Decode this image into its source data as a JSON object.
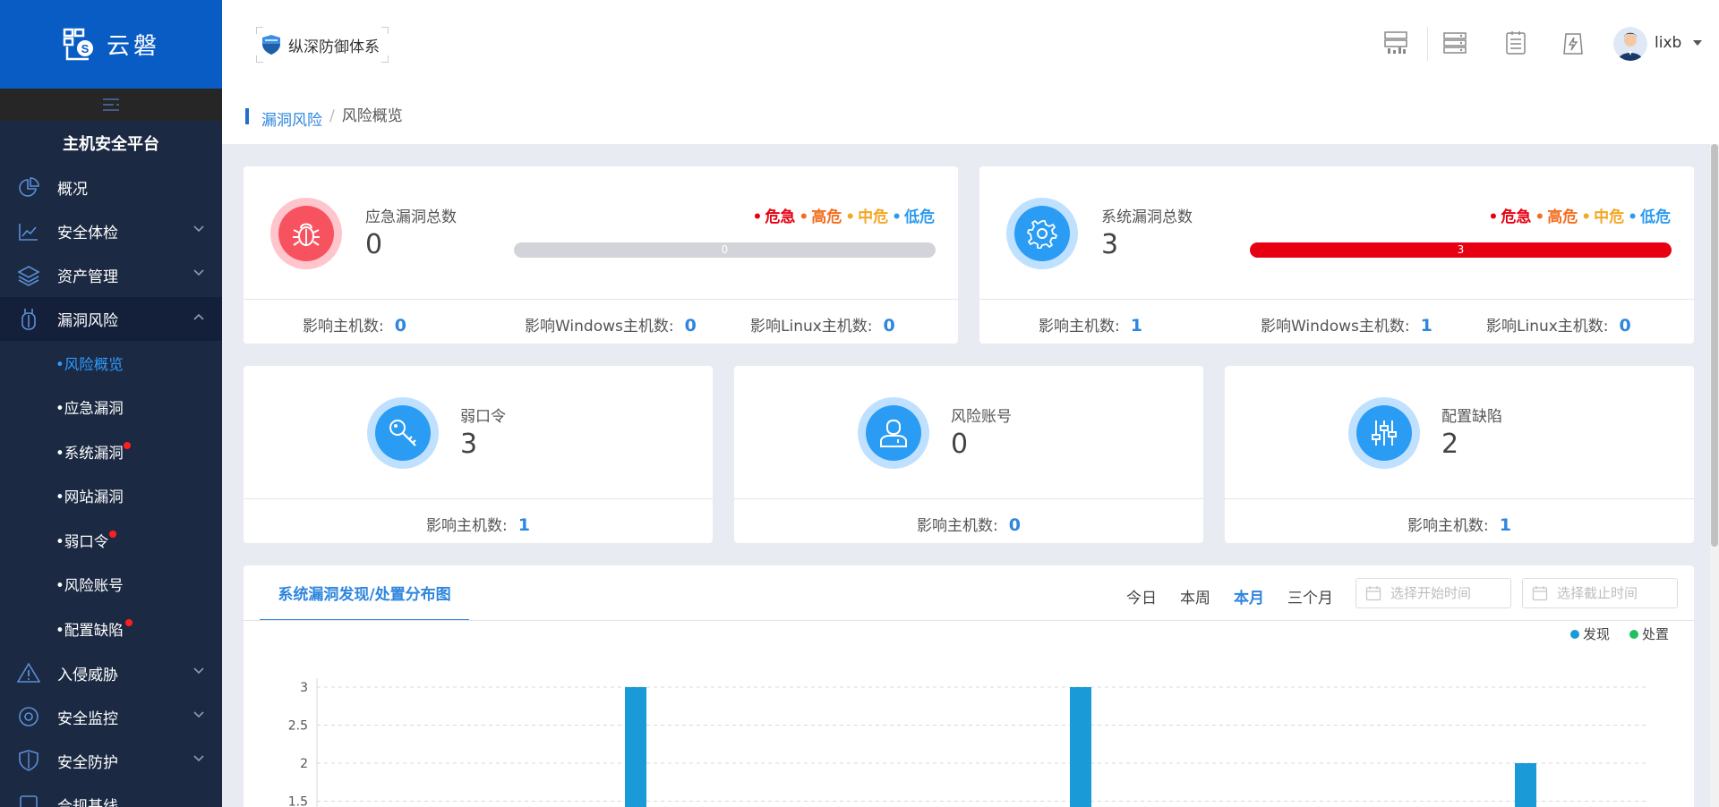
{
  "brand": {
    "name": "云磐"
  },
  "sidebar": {
    "platform_title": "主机安全平台",
    "menu": [
      {
        "label": "概况",
        "icon": "pie-chart-icon"
      },
      {
        "label": "安全体检",
        "icon": "line-chart-icon"
      },
      {
        "label": "资产管理",
        "icon": "layers-icon"
      },
      {
        "label": "漏洞风险",
        "icon": "bug-jar-icon"
      }
    ],
    "submenu": [
      {
        "label": "•风险概览"
      },
      {
        "label": "•应急漏洞"
      },
      {
        "label": "•系统漏洞"
      },
      {
        "label": "•网站漏洞"
      },
      {
        "label": "•弱口令"
      },
      {
        "label": "•风险账号"
      },
      {
        "label": "•配置缺陷"
      }
    ],
    "menu_bottom": [
      {
        "label": "入侵威胁",
        "icon": "warning-icon"
      },
      {
        "label": "安全监控",
        "icon": "monitor-icon"
      },
      {
        "label": "安全防护",
        "icon": "shield-icon"
      },
      {
        "label": "合规基线",
        "icon": "baseline-icon"
      }
    ]
  },
  "header": {
    "defense_tag": "纵深防御体系",
    "user": "lixb"
  },
  "breadcrumb": {
    "parent": "漏洞风险",
    "separator": "/",
    "current": "风险概览"
  },
  "levels": {
    "critical": "危急",
    "high": "高危",
    "mid": "中危",
    "low": "低危",
    "dot": "•"
  },
  "colors": {
    "critical": "#e60012",
    "high": "#f36f20",
    "mid": "#f5a623",
    "low": "#2e9bef",
    "accent": "#2e86de",
    "sidebar": "#1b2942",
    "brand": "#0a5cc5"
  },
  "emergency": {
    "label": "应急漏洞总数",
    "value": "0",
    "bar_text": "0",
    "stats": [
      {
        "label": "影响主机数:",
        "value": "0"
      },
      {
        "label": "影响Windows主机数:",
        "value": "0"
      },
      {
        "label": "影响Linux主机数:",
        "value": "0"
      }
    ]
  },
  "system": {
    "label": "系统漏洞总数",
    "value": "3",
    "bar_text": "3",
    "stats": [
      {
        "label": "影响主机数:",
        "value": "1"
      },
      {
        "label": "影响Windows主机数:",
        "value": "1"
      },
      {
        "label": "影响Linux主机数:",
        "value": "0"
      }
    ]
  },
  "small_cards": [
    {
      "label": "弱口令",
      "value": "3",
      "stat_label": "影响主机数:",
      "stat_value": "1"
    },
    {
      "label": "风险账号",
      "value": "0",
      "stat_label": "影响主机数:",
      "stat_value": "0"
    },
    {
      "label": "配置缺陷",
      "value": "2",
      "stat_label": "影响主机数:",
      "stat_value": "1"
    }
  ],
  "chart_panel": {
    "tab": "系统漏洞发现/处置分布图",
    "ranges": [
      "今日",
      "本周",
      "本月",
      "三个月"
    ],
    "active_range": "本月",
    "start_placeholder": "选择开始时间",
    "end_placeholder": "选择截止时间"
  },
  "chart_data": {
    "type": "bar",
    "series": [
      {
        "name": "发现",
        "color": "#1a9ad6",
        "values": [
          3,
          3,
          2
        ]
      },
      {
        "name": "处置",
        "color": "#21c05f",
        "values": [
          0,
          0,
          0
        ]
      }
    ],
    "ylim": [
      0,
      3
    ],
    "yticks": [
      "3",
      "2.5",
      "2",
      "1.5"
    ],
    "legend": "top-right",
    "grid": true
  }
}
